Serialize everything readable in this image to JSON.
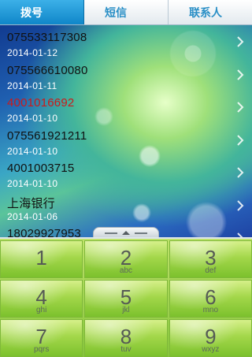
{
  "tabs": [
    {
      "label": "拨号",
      "active": true
    },
    {
      "label": "短信",
      "active": false
    },
    {
      "label": "联系人",
      "active": false
    }
  ],
  "call_log": [
    {
      "number": "075533117308",
      "date": "2014-01-12",
      "missed": false
    },
    {
      "number": "075566610080",
      "date": "2014-01-11",
      "missed": false
    },
    {
      "number": "4001016692",
      "date": "2014-01-10",
      "missed": true
    },
    {
      "number": "075561921211",
      "date": "2014-01-10",
      "missed": false
    },
    {
      "number": "4001003715",
      "date": "2014-01-10",
      "missed": false
    },
    {
      "number": "上海银行",
      "date": "2014-01-06",
      "missed": false
    },
    {
      "number": "18029927953",
      "date": "",
      "missed": false
    }
  ],
  "dialpad": {
    "keys": [
      {
        "digit": "1",
        "letters": ""
      },
      {
        "digit": "2",
        "letters": "abc"
      },
      {
        "digit": "3",
        "letters": "def"
      },
      {
        "digit": "4",
        "letters": "ghi"
      },
      {
        "digit": "5",
        "letters": "jkl"
      },
      {
        "digit": "6",
        "letters": "mno"
      },
      {
        "digit": "7",
        "letters": "pqrs"
      },
      {
        "digit": "8",
        "letters": "tuv"
      },
      {
        "digit": "9",
        "letters": "wxyz"
      }
    ]
  },
  "colors": {
    "tab_active": "#0f86c9",
    "tab_inactive_text": "#2a8fc6",
    "missed_number": "#cc1a1a",
    "dialpad_green": "#a3d74a"
  },
  "icons": {
    "row_chevron": "chevron-right-icon",
    "pad_handle": "chevron-up-icon"
  }
}
